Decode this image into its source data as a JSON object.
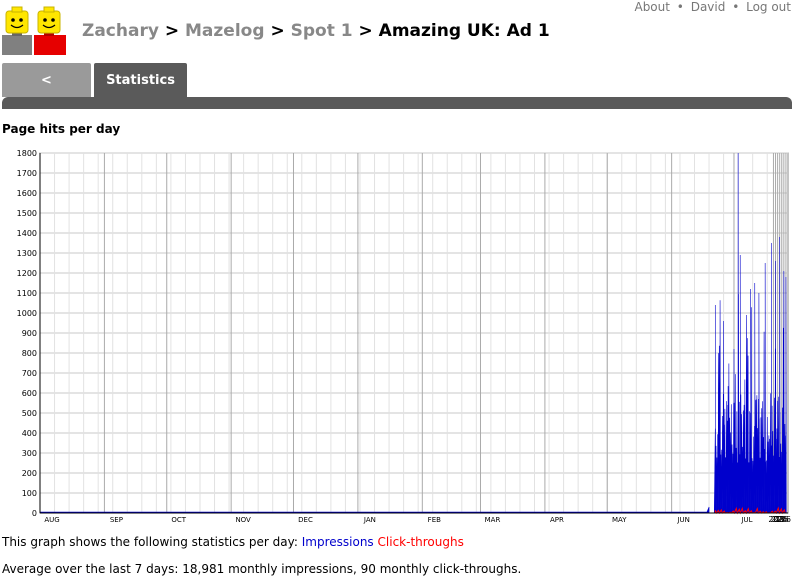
{
  "header": {
    "links": [
      {
        "label": "About"
      },
      {
        "label": "David"
      },
      {
        "label": "Log out"
      }
    ],
    "separator": "•"
  },
  "breadcrumb": {
    "items": [
      "Zachary",
      "Mazelog",
      "Spot 1"
    ],
    "current": "Amazing UK: Ad 1",
    "separator": ">"
  },
  "tabs": {
    "back_label": "<",
    "stats_label": "Statistics"
  },
  "section_title": "Page hits per day",
  "legend": {
    "prefix": "This graph shows the following statistics per day:",
    "impressions": "Impressions",
    "clicks": "Click-throughs"
  },
  "average_text": "Average over the last 7 days: 18,981 monthly impressions, 90 monthly click-throughs.",
  "colors": {
    "impressions": "#0000cc",
    "clicks": "#ff0000",
    "tab_active": "#5a5a5a",
    "tab_inactive": "#9a9a9a",
    "breadcrumb_link": "#888888"
  },
  "chart_data": {
    "type": "bar",
    "ylim": [
      0,
      1800
    ],
    "yticks": [
      0,
      100,
      200,
      300,
      400,
      500,
      600,
      700,
      800,
      900,
      1000,
      1100,
      1200,
      1300,
      1400,
      1500,
      1600,
      1700,
      1800
    ],
    "grid": true,
    "x_range": [
      "2008-08-01",
      "2009-07-27"
    ],
    "month_labels": [
      {
        "date": "2008-08-01",
        "label": "AUG"
      },
      {
        "date": "2008-09-01",
        "label": "SEP"
      },
      {
        "date": "2008-10-01",
        "label": "OCT"
      },
      {
        "date": "2008-11-01",
        "label": "NOV"
      },
      {
        "date": "2008-12-01",
        "label": "DEC"
      },
      {
        "date": "2009-01-01",
        "label": "JAN"
      },
      {
        "date": "2009-02-01",
        "label": "FEB"
      },
      {
        "date": "2009-03-01",
        "label": "MAR"
      },
      {
        "date": "2009-04-01",
        "label": "APR"
      },
      {
        "date": "2009-05-01",
        "label": "MAY"
      },
      {
        "date": "2009-06-01",
        "label": "JUN"
      },
      {
        "date": "2009-07-01",
        "label": "JUL"
      }
    ],
    "day_labels": [
      {
        "date": "2009-07-20",
        "label": "20"
      },
      {
        "date": "2009-07-21",
        "label": "21"
      },
      {
        "date": "2009-07-22",
        "label": "22"
      },
      {
        "date": "2009-07-23",
        "label": "23"
      },
      {
        "date": "2009-07-24",
        "label": "24"
      },
      {
        "date": "2009-07-25",
        "label": "25"
      },
      {
        "date": "2009-07-26",
        "label": "26"
      }
    ],
    "series": [
      {
        "name": "Impressions",
        "color": "#0000cc",
        "segments": [
          {
            "start": "2008-08-01",
            "end": "2009-06-18",
            "value": 5
          },
          {
            "start": "2009-06-19",
            "end": "2009-06-19",
            "value": 30
          }
        ],
        "samples": [
          {
            "date": "2009-06-22",
            "value": 1040
          },
          {
            "date": "2009-06-24",
            "value": 650
          },
          {
            "date": "2009-06-26",
            "value": 960
          },
          {
            "date": "2009-06-28",
            "value": 540
          },
          {
            "date": "2009-07-01",
            "value": 820
          },
          {
            "date": "2009-07-03",
            "value": 1800
          },
          {
            "date": "2009-07-04",
            "value": 1290
          },
          {
            "date": "2009-07-07",
            "value": 990
          },
          {
            "date": "2009-07-09",
            "value": 1120
          },
          {
            "date": "2009-07-11",
            "value": 1150
          },
          {
            "date": "2009-07-13",
            "value": 1100
          },
          {
            "date": "2009-07-16",
            "value": 1250
          },
          {
            "date": "2009-07-19",
            "value": 1350
          },
          {
            "date": "2009-07-21",
            "value": 1260
          },
          {
            "date": "2009-07-23",
            "value": 1380
          },
          {
            "date": "2009-07-25",
            "value": 1210
          },
          {
            "date": "2009-07-26",
            "value": 1180
          }
        ],
        "noise_floor_range": [
          250,
          600
        ]
      },
      {
        "name": "Click-throughs",
        "color": "#ff0000",
        "range": [
          0,
          25
        ]
      }
    ]
  }
}
